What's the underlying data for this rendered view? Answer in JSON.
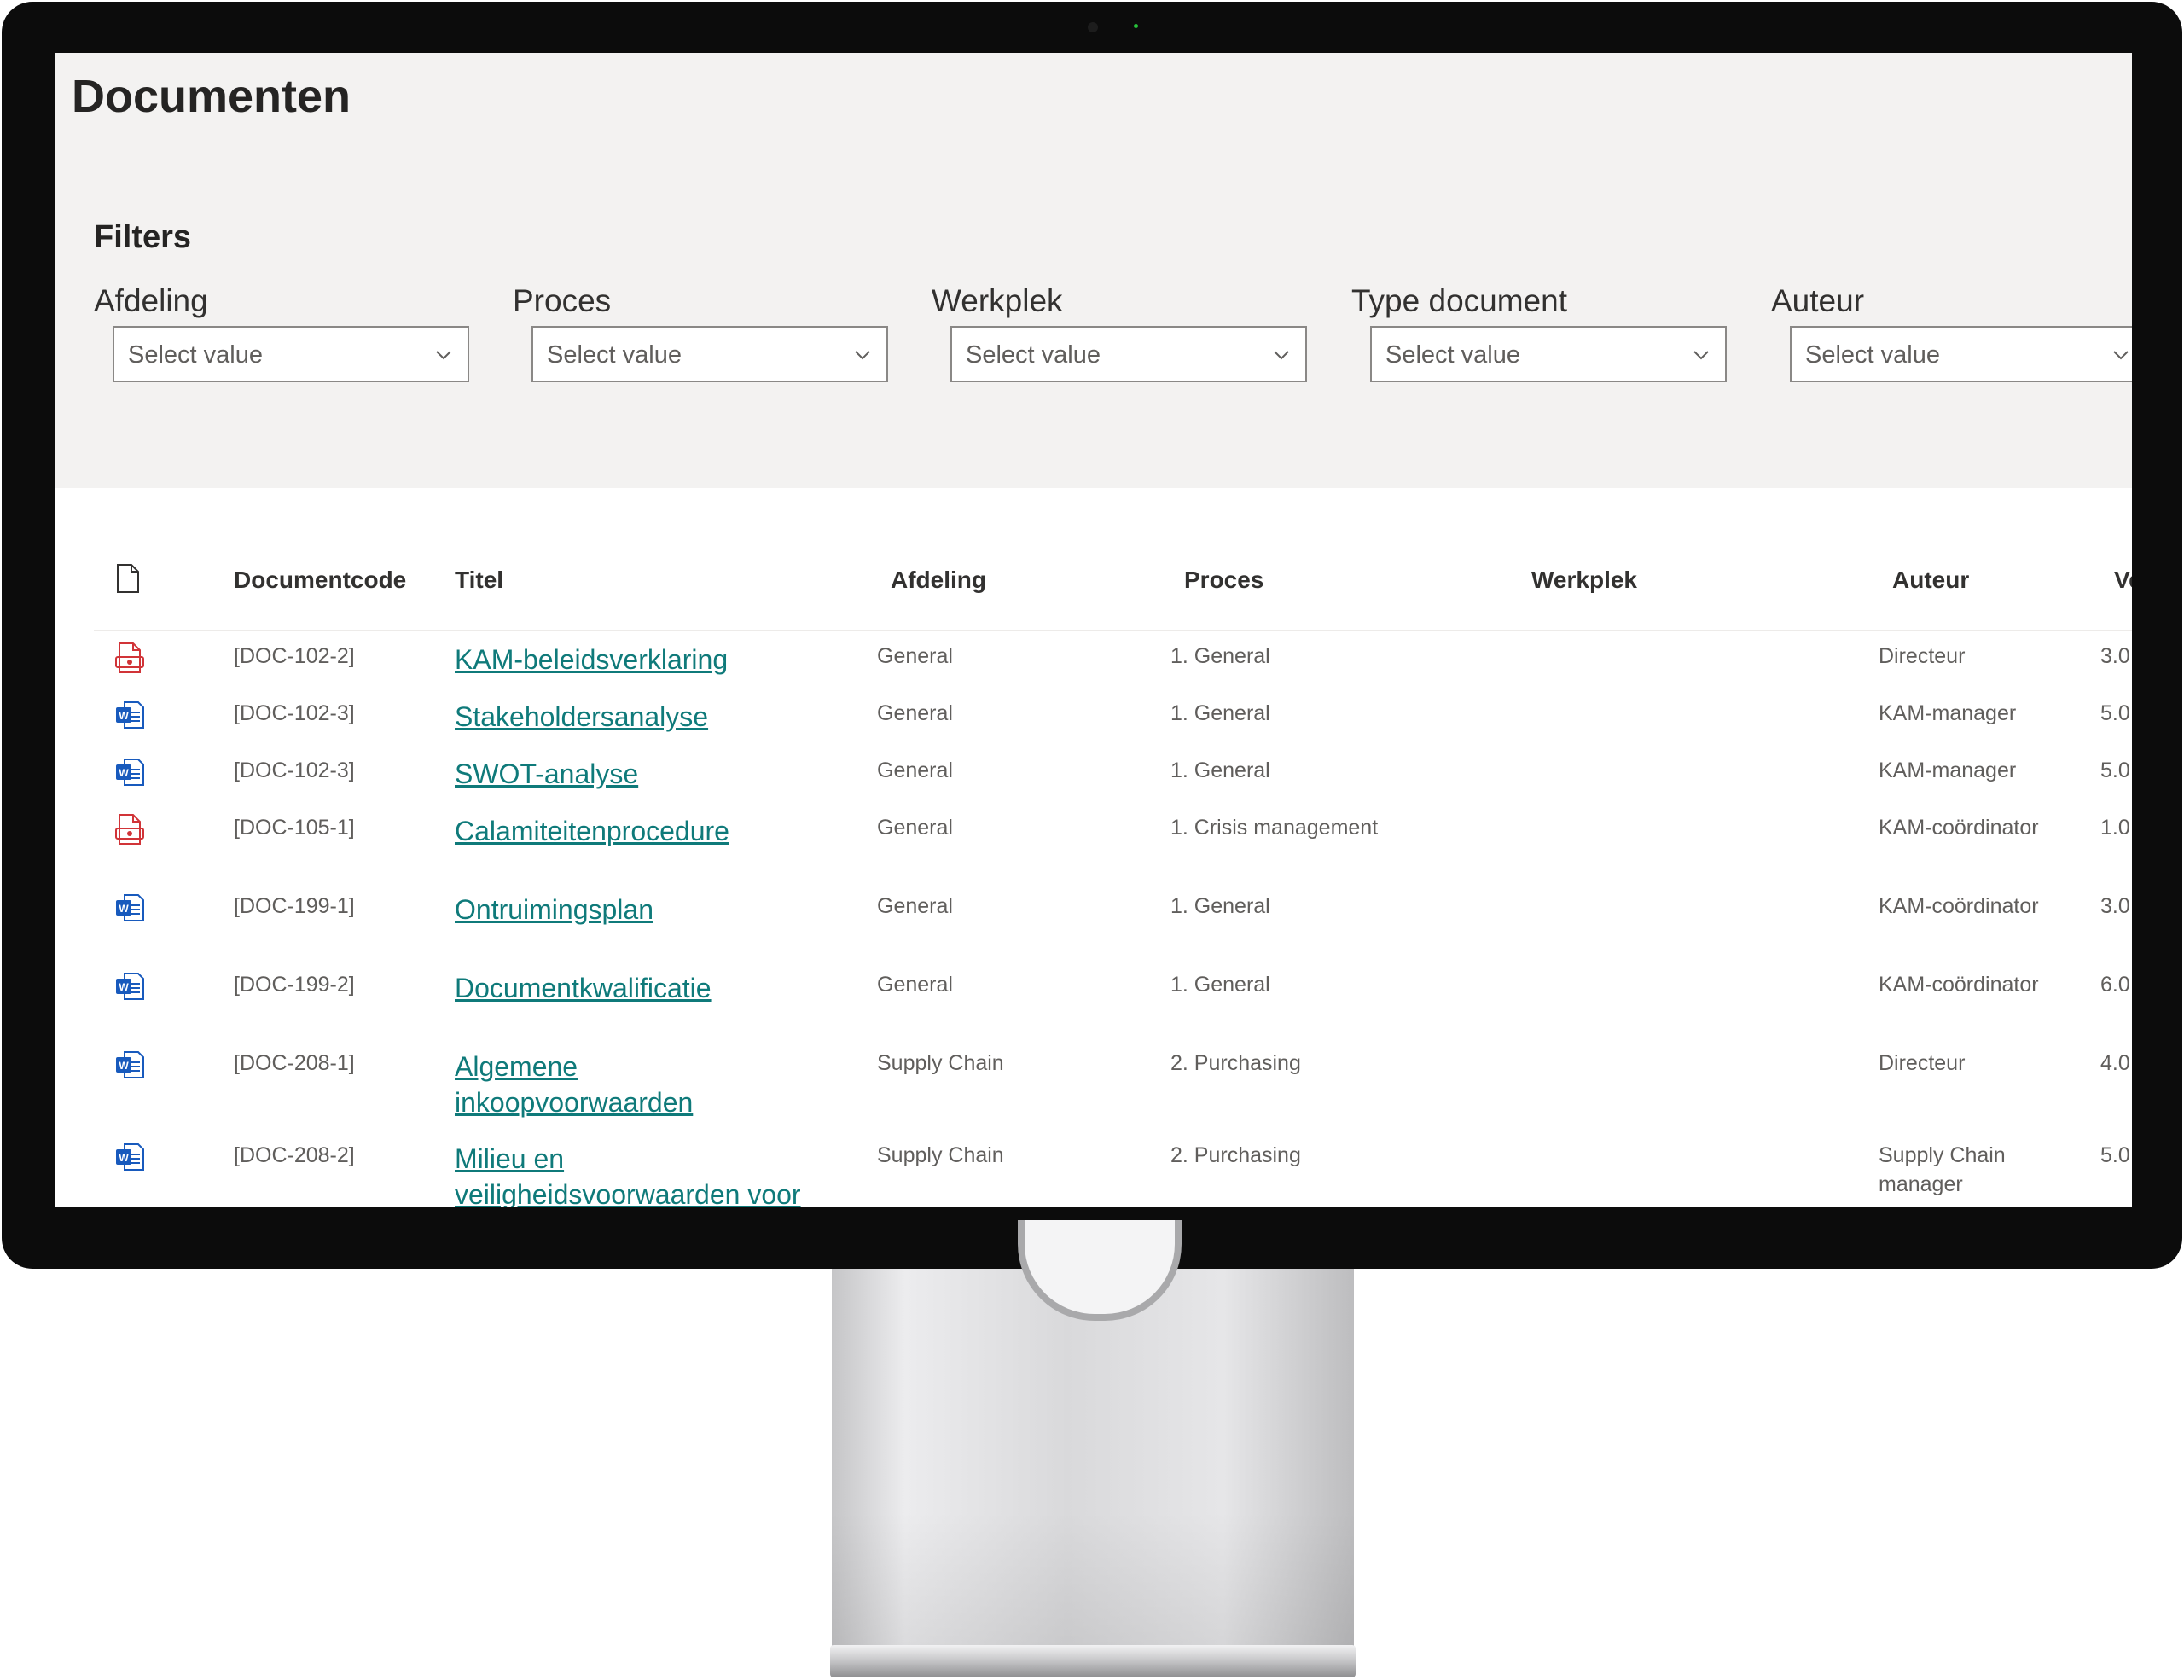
{
  "page": {
    "title": "Documenten"
  },
  "filters": {
    "title": "Filters",
    "items": [
      {
        "label": "Afdeling",
        "placeholder": "Select value"
      },
      {
        "label": "Proces",
        "placeholder": "Select value"
      },
      {
        "label": "Werkplek",
        "placeholder": "Select value"
      },
      {
        "label": "Type document",
        "placeholder": "Select value"
      },
      {
        "label": "Auteur",
        "placeholder": "Select value"
      }
    ]
  },
  "table": {
    "columns": {
      "code": "Documentcode",
      "title": "Titel",
      "afdeling": "Afdeling",
      "proces": "Proces",
      "werkplek": "Werkplek",
      "auteur": "Auteur",
      "versie": "Versie"
    },
    "rows": [
      {
        "type": "pdf",
        "code": "[DOC-102-2]",
        "title": "KAM-beleidsverklaring",
        "afdeling": "General",
        "proces": "1. General",
        "werkplek": "",
        "auteur": "Directeur",
        "versie": "3.0"
      },
      {
        "type": "word",
        "code": "[DOC-102-3]",
        "title": "Stakeholdersanalyse",
        "afdeling": "General",
        "proces": "1. General",
        "werkplek": "",
        "auteur": "KAM-manager",
        "versie": "5.0"
      },
      {
        "type": "word",
        "code": "[DOC-102-3]",
        "title": "SWOT-analyse",
        "afdeling": "General",
        "proces": "1. General",
        "werkplek": "",
        "auteur": "KAM-manager",
        "versie": "5.0"
      },
      {
        "type": "pdf",
        "code": "[DOC-105-1]",
        "title": "Calamiteitenprocedure",
        "afdeling": "General",
        "proces": "1. Crisis management",
        "werkplek": "",
        "auteur": "KAM-coördinator",
        "versie": "1.0"
      },
      {
        "type": "word",
        "code": "[DOC-199-1]",
        "title": "Ontruimingsplan",
        "afdeling": "General",
        "proces": "1. General",
        "werkplek": "",
        "auteur": "KAM-coördinator",
        "versie": "3.0"
      },
      {
        "type": "word",
        "code": "[DOC-199-2]",
        "title": "Documentkwalificatie",
        "afdeling": "General",
        "proces": "1. General",
        "werkplek": "",
        "auteur": "KAM-coördinator",
        "versie": "6.0"
      },
      {
        "type": "word",
        "code": "[DOC-208-1]",
        "title": "Algemene inkoopvoorwaarden",
        "afdeling": "Supply Chain",
        "proces": "2. Purchasing",
        "werkplek": "",
        "auteur": "Directeur",
        "versie": "4.0"
      },
      {
        "type": "word",
        "code": "[DOC-208-2]",
        "title": "Milieu en veiligheidsvoorwaarden voor onderaannemers",
        "afdeling": "Supply Chain",
        "proces": "2. Purchasing",
        "werkplek": "",
        "auteur": "Supply Chain manager",
        "versie": "5.0"
      }
    ]
  },
  "colors": {
    "link": "#0f7a7a",
    "filter_bg": "#f3f2f1",
    "pdf_icon": "#d13438",
    "word_icon": "#185abd",
    "bezel": "#0c0c0c"
  },
  "icons": {
    "pdf": "pdf-file-icon",
    "word": "word-file-icon",
    "header": "document-icon",
    "dropdown": "chevron-down-icon"
  }
}
